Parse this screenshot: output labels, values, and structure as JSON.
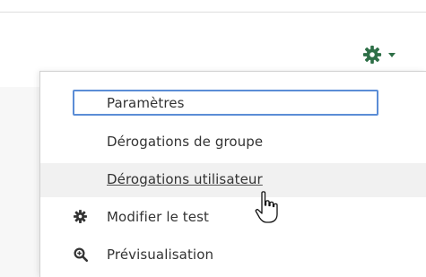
{
  "toolbar": {
    "settings_icon": "gear-icon",
    "dropdown_icon": "caret-down-icon",
    "accent_color": "#2e6f47"
  },
  "menu": {
    "items": [
      {
        "label": "Paramètres",
        "icon": null,
        "state": "focused"
      },
      {
        "label": "Dérogations de groupe",
        "icon": null,
        "state": "normal"
      },
      {
        "label": "Dérogations utilisateur",
        "icon": null,
        "state": "hovered"
      },
      {
        "label": "Modifier le test",
        "icon": "gear-icon",
        "state": "normal"
      },
      {
        "label": "Prévisualisation",
        "icon": "zoom-in-icon",
        "state": "normal"
      }
    ],
    "focus_color": "#5b8dd6",
    "hover_bg": "#f1f1f1"
  },
  "cursor": {
    "icon": "hand-pointer-icon"
  }
}
